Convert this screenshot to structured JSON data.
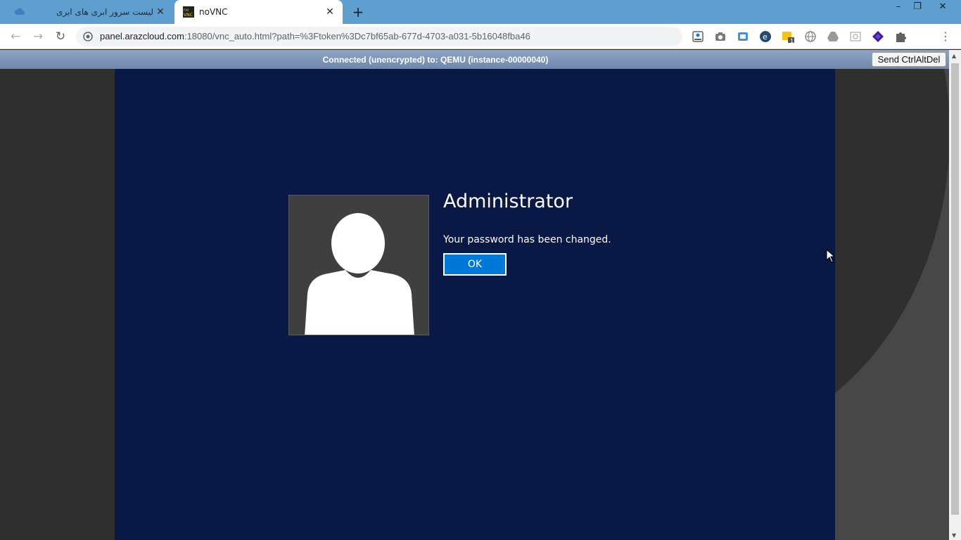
{
  "browser": {
    "tabs": [
      {
        "title": "لیست سرور ابری های ابری",
        "favicon": "cloud-icon",
        "active": false
      },
      {
        "title": "noVNC",
        "favicon": "novnc-icon",
        "active": true
      }
    ],
    "new_tab_glyph": "+",
    "close_glyph": "✕",
    "window_controls": {
      "minimize": "–",
      "restore": "❐",
      "close": "✕"
    },
    "url_host": "panel.arazcloud.com",
    "url_path": ":18080/vnc_auto.html?path=%3Ftoken%3Dc7bf65ab-677d-4703-a031-5b16048fba46",
    "extension_badge": "1"
  },
  "vnc": {
    "status": "Connected (unencrypted) to: QEMU (instance-00000040)",
    "send_cad_label": "Send CtrlAltDel"
  },
  "remote": {
    "username": "Administrator",
    "message": "Your password has been changed.",
    "ok_label": "OK",
    "colors": {
      "background": "#091845",
      "button": "#0078d7"
    }
  }
}
